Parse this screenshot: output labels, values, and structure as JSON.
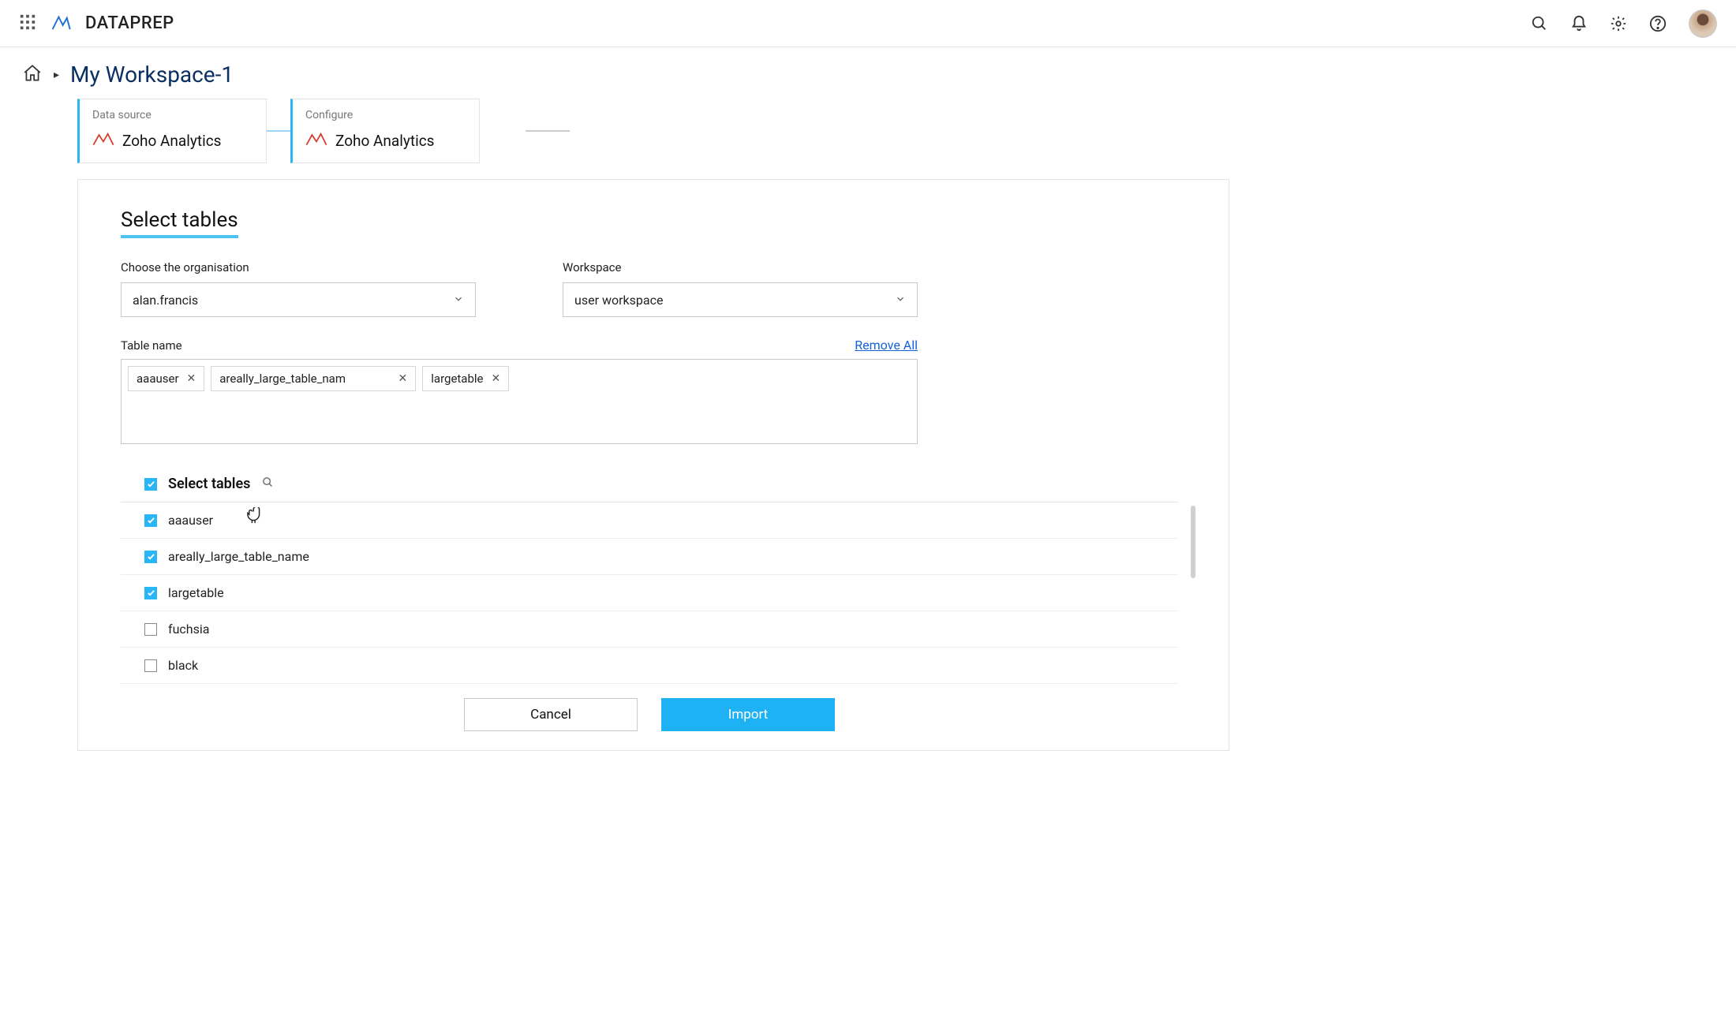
{
  "header": {
    "brand": "DATAPREP"
  },
  "breadcrumb": {
    "workspace": "My Workspace-1"
  },
  "steps": {
    "card1_label": "Data source",
    "card1_name": "Zoho Analytics",
    "card2_label": "Configure",
    "card2_name": "Zoho Analytics"
  },
  "panel": {
    "title": "Select tables",
    "org_label": "Choose the organisation",
    "org_value": "alan.francis",
    "ws_label": "Workspace",
    "ws_value": "user workspace",
    "tablename_label": "Table name",
    "remove_all": "Remove All",
    "tags": [
      "aaauser",
      "areally_large_table_nam",
      "largetable"
    ],
    "tables_header": "Select tables",
    "tables": [
      {
        "name": "aaauser",
        "checked": true
      },
      {
        "name": "areally_large_table_name",
        "checked": true
      },
      {
        "name": "largetable",
        "checked": true
      },
      {
        "name": "fuchsia",
        "checked": false
      },
      {
        "name": "black",
        "checked": false
      }
    ],
    "cancel": "Cancel",
    "import": "Import"
  }
}
